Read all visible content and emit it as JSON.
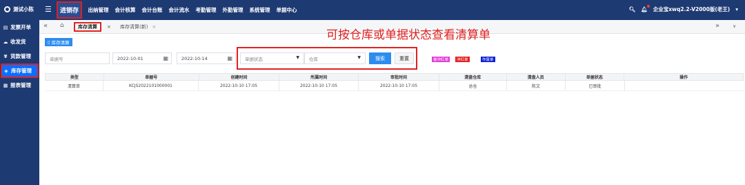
{
  "topbar": {
    "brand": "测试小陈",
    "nav": [
      "进销存",
      "出纳管理",
      "会计核算",
      "会计台账",
      "会计流水",
      "考勤管理",
      "外勤管理",
      "系统管理",
      "单据中心"
    ],
    "user": "企业宝xwq2.2-V2000版(老王)"
  },
  "sidebar": {
    "items": [
      {
        "label": "发票开单",
        "icon": "invoice-icon"
      },
      {
        "label": "收发货",
        "icon": "cloud-icon"
      },
      {
        "label": "货款管理",
        "icon": "money-icon"
      },
      {
        "label": "库存管理",
        "icon": "layers-icon"
      },
      {
        "label": "报表管理",
        "icon": "report-icon"
      }
    ]
  },
  "tabs": [
    {
      "label": "库存清算",
      "close": "×"
    },
    {
      "label": "库存清算(新)",
      "close": "×"
    }
  ],
  "annotation": "可按仓库或单据状态查看清算单",
  "page_button": "库存清算",
  "filters": {
    "doc_no_placeholder": "单据号",
    "date_from": "2022-10-01",
    "date_to": "2022-10-14",
    "status_placeholder": "单据状态",
    "warehouse_placeholder": "仓库"
  },
  "buttons": {
    "search": "搜索",
    "reset": "重置"
  },
  "legend": {
    "b1": "被冲红单",
    "b2": "冲红单",
    "b3": "作废单",
    "colors": [
      "#e03cd9",
      "#e02020",
      "#0a1fd6"
    ]
  },
  "table": {
    "headers": [
      "类型",
      "单据号",
      "创建时间",
      "所属时间",
      "审批时间",
      "清盘仓库",
      "清盘人员",
      "单据状态",
      "操作"
    ],
    "rows": [
      [
        "清算单",
        "KCJS2022101000001",
        "2022-10-10 17:05",
        "2022-10-10 17:05",
        "2022-10-10 17:05",
        "总仓",
        "陈文",
        "已审批",
        ""
      ]
    ]
  }
}
